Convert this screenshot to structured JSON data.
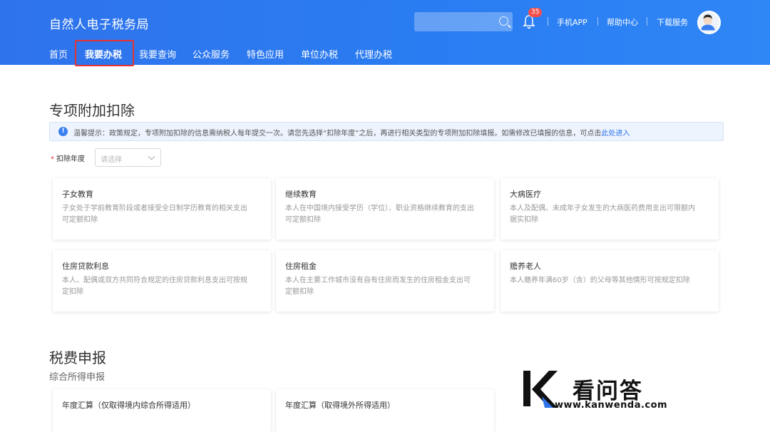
{
  "header": {
    "title": "自然人电子税务局",
    "notification_count": "35",
    "links": [
      "手机APP",
      "帮助中心",
      "下载服务"
    ]
  },
  "nav": {
    "items": [
      "首页",
      "我要办税",
      "我要查询",
      "公众服务",
      "特色应用",
      "单位办税",
      "代理办税"
    ],
    "active": "我要办税"
  },
  "deduction": {
    "title": "专项附加扣除",
    "notice_prefix": "温馨提示：政策规定，专项附加扣除的信息需纳税人每年提交一次。请您先选择“扣除年度”之后，再进行相关类型的专项附加扣除填报。如需修改已填报的信息，可点击",
    "notice_link": "此处进入",
    "year_label": "扣除年度",
    "year_placeholder": "请选择",
    "cards": [
      {
        "title": "子女教育",
        "desc": "子女处于学前教育阶段或者接受全日制学历教育的相关支出可定额扣除"
      },
      {
        "title": "继续教育",
        "desc": "本人在中国境内接受学历（学位）、职业资格继续教育的支出可定额扣除"
      },
      {
        "title": "大病医疗",
        "desc": "本人及配偶、未成年子女发生的大病医药费用支出可限额内据实扣除"
      },
      {
        "title": "住房贷款利息",
        "desc": "本人、配偶或双方共同符合规定的住房贷款利息支出可按规定扣除"
      },
      {
        "title": "住房租金",
        "desc": "本人在主要工作城市没有自有住房而发生的住房租金支出可定额扣除"
      },
      {
        "title": "赡养老人",
        "desc": "本人赡养年满60岁（含）的父母等其他情形可按规定扣除"
      }
    ]
  },
  "tax": {
    "title": "税费申报",
    "subtitle": "综合所得申报",
    "cards": [
      {
        "title": "年度汇算（仅取得境内综合所得适用）"
      },
      {
        "title": "年度汇算（取得境外所得适用）"
      }
    ]
  },
  "watermark": {
    "text": "看问答",
    "url": "www.kanwenda.com"
  },
  "colors": {
    "header_blue": "#2f73ec",
    "highlight_red": "#e53331",
    "notice_bg": "#edf4fd"
  }
}
